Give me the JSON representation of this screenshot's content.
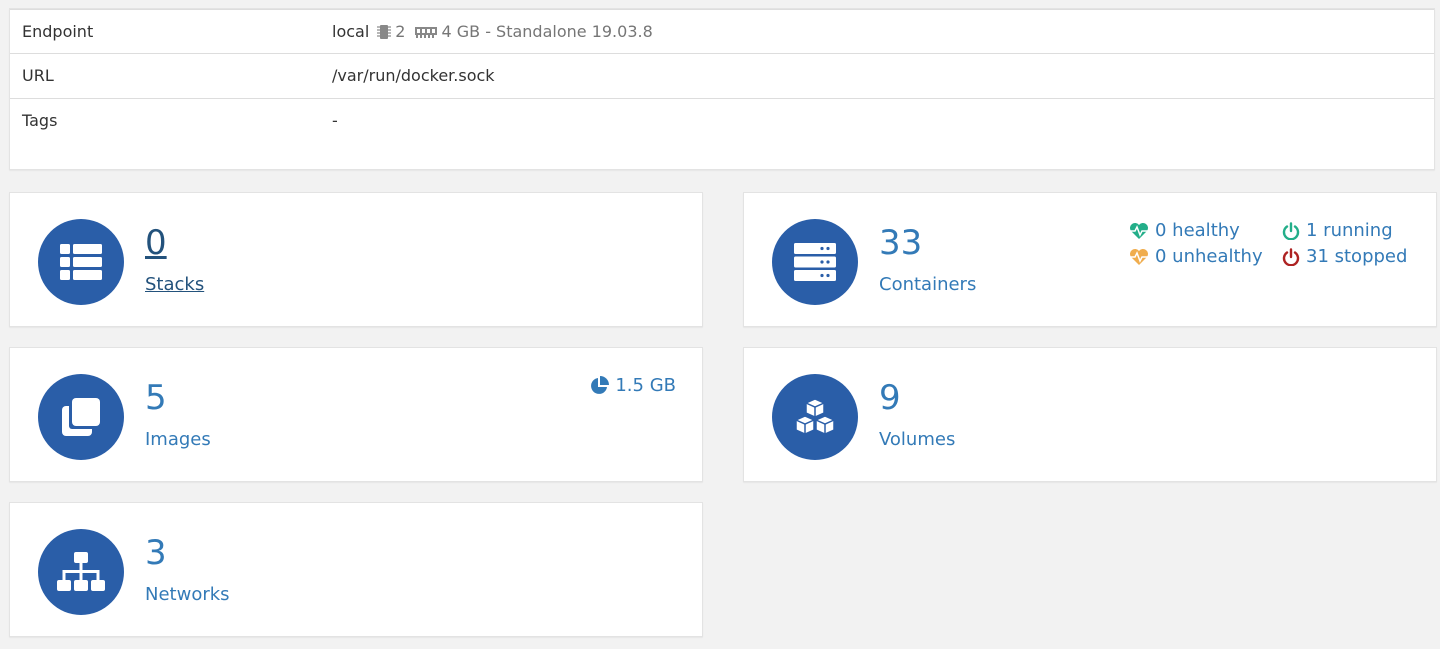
{
  "endpoint_info": {
    "rows": [
      {
        "label": "Endpoint",
        "value": "local",
        "cpu": "2",
        "memory": "4 GB - Standalone 19.03.8"
      },
      {
        "label": "URL",
        "value": "/var/run/docker.sock"
      },
      {
        "label": "Tags",
        "value": "-"
      }
    ]
  },
  "cards": {
    "stacks": {
      "count": "0",
      "label": "Stacks",
      "icon": "th-list-icon"
    },
    "containers": {
      "count": "33",
      "label": "Containers",
      "icon": "server-icon",
      "healthy": "0 healthy",
      "unhealthy": "0 unhealthy",
      "running": "1 running",
      "stopped": "31 stopped"
    },
    "images": {
      "count": "5",
      "label": "Images",
      "icon": "clone-icon",
      "size": "1.5 GB"
    },
    "volumes": {
      "count": "9",
      "label": "Volumes",
      "icon": "cubes-icon"
    },
    "networks": {
      "count": "3",
      "label": "Networks",
      "icon": "sitemap-icon"
    }
  },
  "colors": {
    "accent": "#337ab7",
    "icon_circle": "#2a5ea8",
    "healthy": "#23ae89",
    "unhealthy": "#f0ad4e",
    "running": "#23ae89",
    "stopped": "#ae2323"
  }
}
